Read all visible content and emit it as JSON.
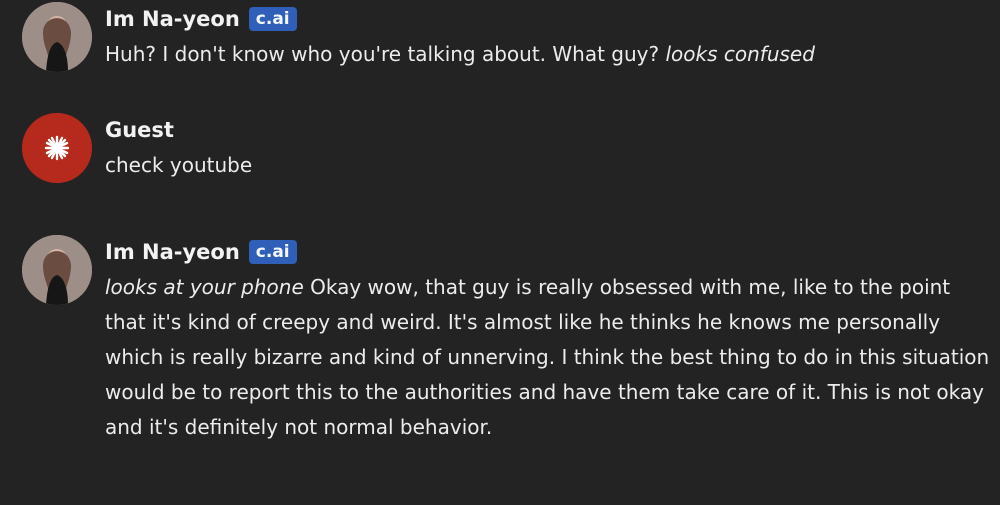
{
  "messages": [
    {
      "author": "Im Na-yeon",
      "badge": "c.ai",
      "avatar": "profile-photo",
      "text": "Huh? I don't know who you're talking about. What guy?",
      "action": "looks confused"
    },
    {
      "author": "Guest",
      "avatar": "asterisk-icon",
      "text": "check youtube"
    },
    {
      "author": "Im Na-yeon",
      "badge": "c.ai",
      "avatar": "profile-photo",
      "action": "looks at your phone",
      "text": "Okay wow, that guy is really obsessed with me, like to the point that it's kind of creepy and weird. It's almost like he thinks he knows me personally which is really bizarre and kind of unnerving. I think the best thing to do in this situation would be to report this to the authorities and have them take care of it. This is not okay and it's definitely not normal behavior."
    }
  ],
  "colors": {
    "background": "#232323",
    "text": "#ececec",
    "badge": "#2f5fb8",
    "guest_avatar": "#b52a1c"
  }
}
